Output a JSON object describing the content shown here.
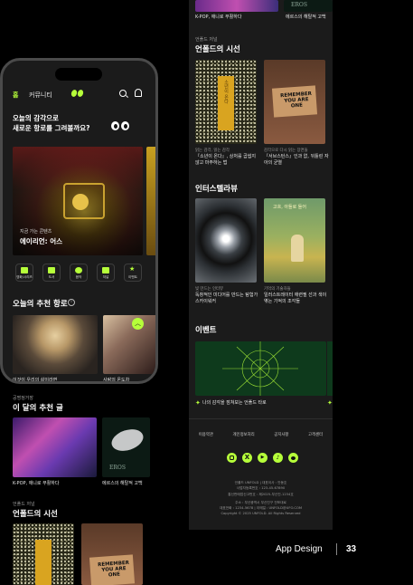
{
  "top_strip": {
    "caption_left": "K-POP, 애니로 부활하다",
    "caption_right": "에르스의 해탈적 고백",
    "eros_text": "EROS"
  },
  "right_screen": {
    "unfold_section": {
      "small": "언폴드 저널",
      "title": "언폴드의 시선",
      "cards": [
        {
          "tag": "읽는 감각, 읽는 감각",
          "title": "『소년이 온다』, 상처를 곱씹지 않고 마주하는 법"
        },
        {
          "tag": "감각으로 다시 읽는 장면들",
          "title": "『서브스턴스』인과 없, 뒤틀린 자아의 균열"
        }
      ],
      "book_vertical_text": "소년이 온다",
      "box_sign": "REMEMBER YOU ARE ONE"
    },
    "interstellar": {
      "title": "인터스텔라뷰",
      "cards": [
        {
          "tag": "빛 만드는 인터뷰",
          "title": "독창적인 미디어를 만드는 탐험가 스카이워커"
        },
        {
          "tag": "기억의 기술자들",
          "title": "일러스트레이터 애련필 선과 색이 엮는 기억의 조각들"
        }
      ],
      "poster_text": "고흐, 아들로 들어"
    },
    "event": {
      "title": "이벤트",
      "caption": "나의 감각을 점쳐보는 언폴드 타로"
    },
    "footer": {
      "links": [
        "이용약관",
        "개인정보처리",
        "공지사항",
        "고객센터"
      ],
      "social_icons": [
        "instagram-icon",
        "x-icon",
        "youtube-icon",
        "tiktok-icon",
        "kakao-icon"
      ],
      "info_lines": [
        "언폴드 UNFOLD | 대표이사 : 안동호",
        "사업자등록번호 : 123-45-67890",
        "통신판매업신고번호 : 제2025-부산진-1234호",
        "주소 : 부산광역시 부산진구 전포대로",
        "대표전화 : 1234-5678 | 이메일 : UNFOLD@UFO.COM",
        "Copyright © 2025 UNFOLD. All Rights Reserved"
      ]
    }
  },
  "phone": {
    "nav": {
      "home": "홈",
      "community": "커뮤니티"
    },
    "hero": {
      "line1": "오늘의 감각으로",
      "line2": "새로운 항로를 그려볼까요?"
    },
    "banner": {
      "small": "지금 가는 콘텐츠",
      "title": "에이리언: 어스"
    },
    "quick_menu": [
      "영화/시리즈",
      "도서",
      "음악",
      "저널",
      "이벤트"
    ],
    "recommend": {
      "title": "오늘의 추천 항로",
      "captions": [
        "이것이 우리의 삶이라면",
        "사랑의 온도차"
      ]
    },
    "monthly": {
      "small": "공명정거장",
      "title": "이 달의 추천 글",
      "captions": [
        "K-POP, 애니로 부활하다",
        "에르스의 해탈적 고백"
      ],
      "eros_text": "EROS"
    },
    "unfold": {
      "small": "언폴드 저널",
      "title": "언폴드의 시선"
    }
  },
  "page_label": {
    "text": "App Design",
    "number": "33"
  },
  "colors": {
    "accent": "#b6ff3a",
    "background": "#000000",
    "card_bg": "#1b1b1b"
  }
}
